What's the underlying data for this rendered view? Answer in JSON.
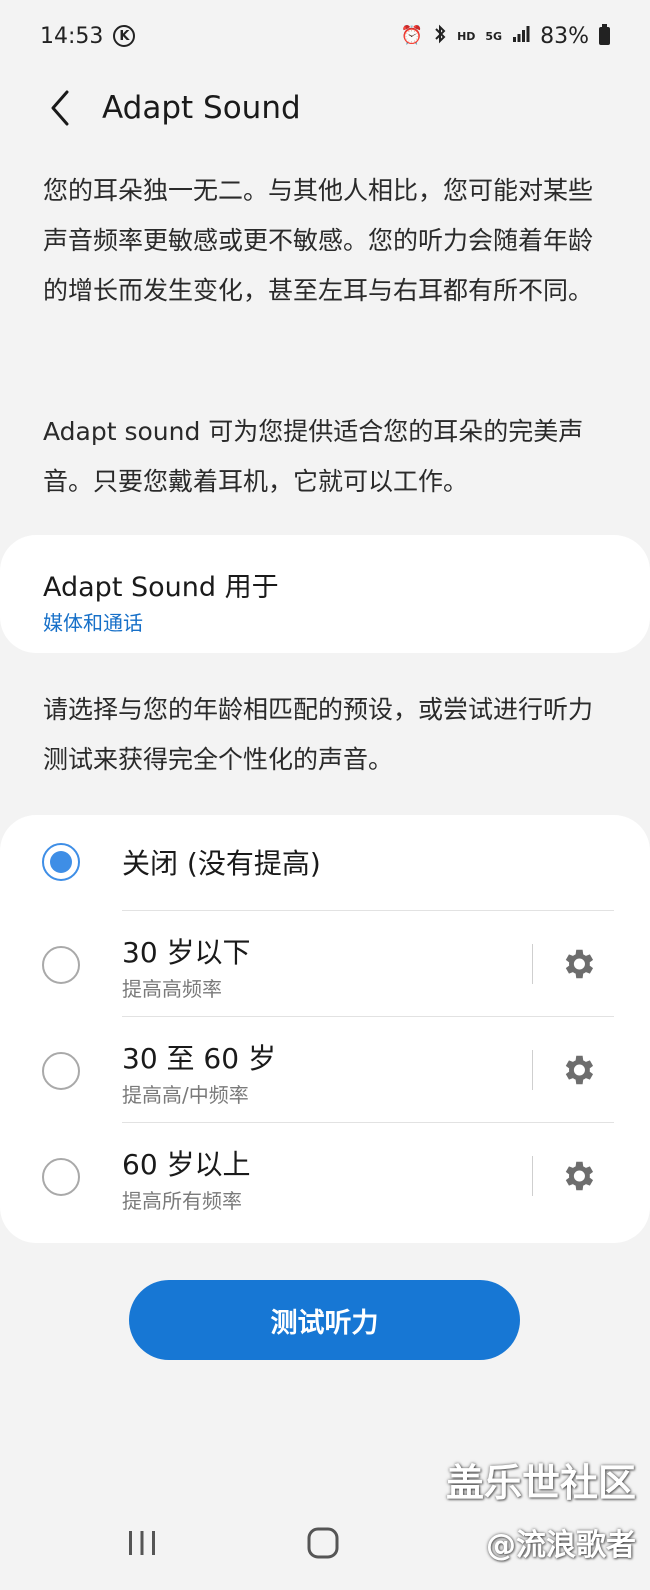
{
  "status_bar": {
    "time": "14:53",
    "hd_label": "HD",
    "net_label": "5G",
    "battery": "83%"
  },
  "header": {
    "title": "Adapt Sound"
  },
  "intro": {
    "paragraph1": "您的耳朵独一无二。与其他人相比，您可能对某些声音频率更敏感或更不敏感。您的听力会随着年龄的增长而发生变化，甚至左耳与右耳都有所不同。",
    "paragraph2": "Adapt sound 可为您提供适合您的耳朵的完美声音。只要您戴着耳机，它就可以工作。"
  },
  "use_for": {
    "title": "Adapt Sound 用于",
    "value": "媒体和通话"
  },
  "preset_hint": "请选择与您的年龄相匹配的预设，或尝试进行听力测试来获得完全个性化的声音。",
  "options": [
    {
      "label": "关闭 (没有提高)",
      "sub": "",
      "selected": true
    },
    {
      "label": "30 岁以下",
      "sub": "提高高频率",
      "selected": false
    },
    {
      "label": "30 至 60 岁",
      "sub": "提高高/中频率",
      "selected": false
    },
    {
      "label": "60 岁以上",
      "sub": "提高所有频率",
      "selected": false
    }
  ],
  "test_button": "测试听力",
  "watermark": {
    "line1": "盖乐世社区",
    "line2": "@流浪歌者"
  },
  "colors": {
    "accent": "#1777d4",
    "link": "#1770c8",
    "radio": "#3e8ee6",
    "background": "#f3f3f3"
  }
}
